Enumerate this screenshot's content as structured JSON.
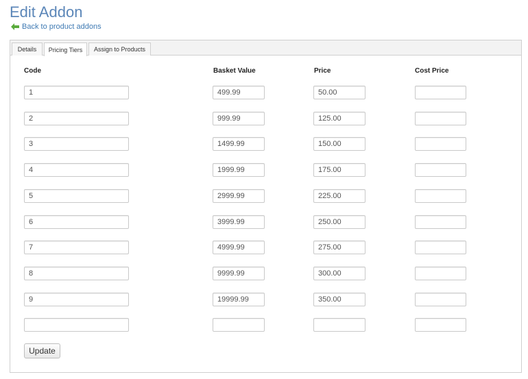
{
  "page": {
    "title": "Edit Addon",
    "back_link": "Back to product addons"
  },
  "tabs": [
    {
      "label": "Details",
      "active": false
    },
    {
      "label": "Pricing Tiers",
      "active": true
    },
    {
      "label": "Assign to Products",
      "active": false
    }
  ],
  "columns": {
    "code": "Code",
    "basket_value": "Basket Value",
    "price": "Price",
    "cost_price": "Cost Price"
  },
  "tiers": [
    {
      "code": "1",
      "basket_value": "499.99",
      "price": "50.00",
      "cost_price": ""
    },
    {
      "code": "2",
      "basket_value": "999.99",
      "price": "125.00",
      "cost_price": ""
    },
    {
      "code": "3",
      "basket_value": "1499.99",
      "price": "150.00",
      "cost_price": ""
    },
    {
      "code": "4",
      "basket_value": "1999.99",
      "price": "175.00",
      "cost_price": ""
    },
    {
      "code": "5",
      "basket_value": "2999.99",
      "price": "225.00",
      "cost_price": ""
    },
    {
      "code": "6",
      "basket_value": "3999.99",
      "price": "250.00",
      "cost_price": ""
    },
    {
      "code": "7",
      "basket_value": "4999.99",
      "price": "275.00",
      "cost_price": ""
    },
    {
      "code": "8",
      "basket_value": "9999.99",
      "price": "300.00",
      "cost_price": ""
    },
    {
      "code": "9",
      "basket_value": "19999.99",
      "price": "350.00",
      "cost_price": ""
    },
    {
      "code": "",
      "basket_value": "",
      "price": "",
      "cost_price": ""
    }
  ],
  "buttons": {
    "update": "Update"
  },
  "colors": {
    "title": "#5b86b8",
    "link": "#3f7ab3",
    "back_arrow": "#5aab3c"
  },
  "icons": {
    "back": "left-arrow-icon"
  }
}
